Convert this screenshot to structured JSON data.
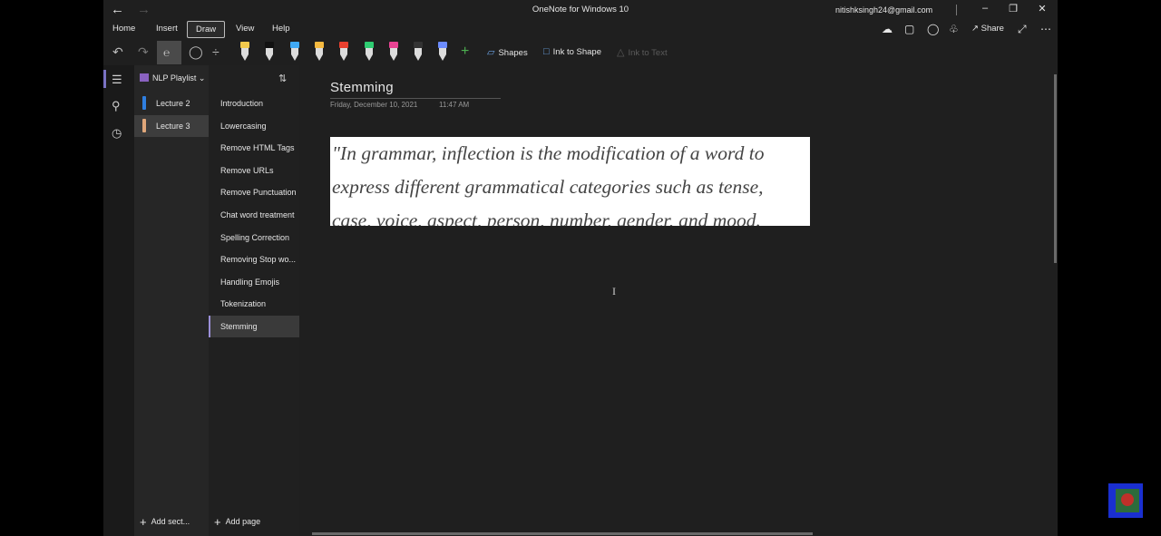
{
  "app": {
    "title": "OneNote for Windows 10",
    "user": "nitishksingh24@gmail.com"
  },
  "tabs": [
    "Home",
    "Insert",
    "Draw",
    "View",
    "Help"
  ],
  "active_tab": "Draw",
  "share_label": "Share",
  "toolbar": {
    "shapes_label": "Shapes",
    "ink_to_shape_label": "Ink to Shape",
    "ink_to_text_label": "Ink to Text",
    "pens": [
      {
        "name": "yellow-highlighter",
        "color": "#f2c94c"
      },
      {
        "name": "black-pen",
        "color": "#111111"
      },
      {
        "name": "blue-pen",
        "color": "#3fa9f5"
      },
      {
        "name": "yellow-pen",
        "color": "#f5b93f"
      },
      {
        "name": "red-pen",
        "color": "#e8402f"
      },
      {
        "name": "green-pen",
        "color": "#2ecc71"
      },
      {
        "name": "pink-pen",
        "color": "#e84393"
      },
      {
        "name": "dark-pen",
        "color": "#333333"
      },
      {
        "name": "purple-blue-pen",
        "color": "#6c8cff"
      }
    ]
  },
  "notebook": {
    "name": "NLP Playlist",
    "sections": [
      {
        "label": "Lecture 2",
        "color": "#2f7fe0",
        "selected": false
      },
      {
        "label": "Lecture 3",
        "color": "#e0a77a",
        "selected": true
      }
    ],
    "add_section_label": "Add sect...",
    "add_page_label": "Add page",
    "pages": [
      {
        "label": "Introduction",
        "selected": false
      },
      {
        "label": "Lowercasing",
        "selected": false
      },
      {
        "label": "Remove HTML Tags",
        "selected": false
      },
      {
        "label": "Remove URLs",
        "selected": false
      },
      {
        "label": "Remove Punctuation",
        "selected": false
      },
      {
        "label": "Chat word treatment",
        "selected": false
      },
      {
        "label": "Spelling Correction",
        "selected": false
      },
      {
        "label": "Removing Stop wo...",
        "selected": false
      },
      {
        "label": "Handling Emojis",
        "selected": false
      },
      {
        "label": "Tokenization",
        "selected": false
      },
      {
        "label": "Stemming",
        "selected": true
      }
    ]
  },
  "page": {
    "title": "Stemming",
    "date": "Friday, December 10, 2021",
    "time": "11:47 AM",
    "quote_lines": [
      "\"In grammar, inflection is the modification of a word to",
      "express different grammatical categories such as tense,",
      "case, voice, aspect, person, number, gender, and mood."
    ]
  }
}
